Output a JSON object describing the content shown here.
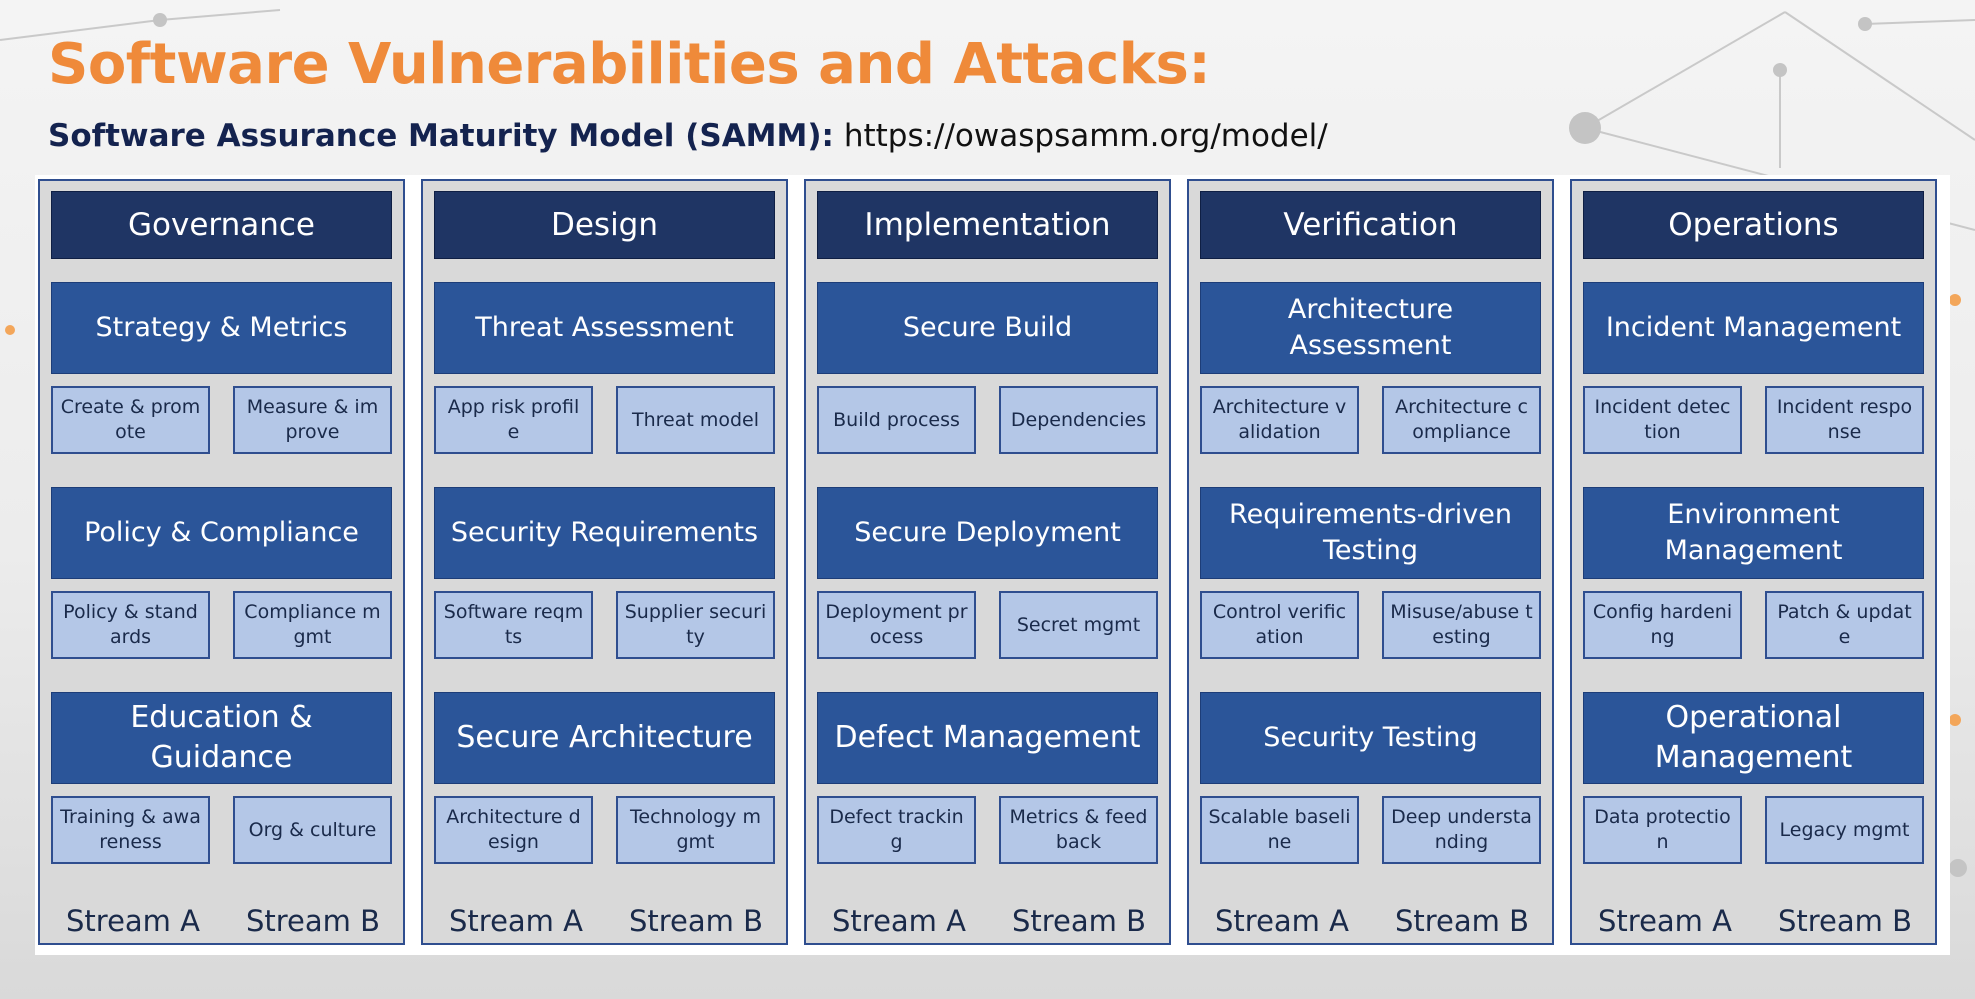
{
  "slide": {
    "title": "Software Vulnerabilities and Attacks:",
    "subtitle_bold": "Software Assurance Maturity Model (SAMM):",
    "subtitle_url": "https://owaspsamm.org/model/"
  },
  "colors": {
    "title": "#ef8a3a",
    "header": "#1f3564",
    "practice": "#2b5599",
    "activity": "#b4c7e7",
    "column": "#d9d9d9"
  },
  "columns": [
    {
      "header": "Governance",
      "practices": [
        {
          "label": "Strategy & Metrics",
          "activities": [
            "Create & promote",
            "Measure & improve"
          ]
        },
        {
          "label": "Policy & Compliance",
          "activities": [
            "Policy & standards",
            "Compliance mgmt"
          ]
        },
        {
          "label": "Education & Guidance",
          "activities": [
            "Training & awareness",
            "Org & culture"
          ]
        }
      ],
      "stream_a": "Stream A",
      "stream_b": "Stream B"
    },
    {
      "header": "Design",
      "practices": [
        {
          "label": "Threat Assessment",
          "activities": [
            "App risk profile",
            "Threat model"
          ]
        },
        {
          "label": "Security Requirements",
          "activities": [
            "Software reqmts",
            "Supplier security"
          ]
        },
        {
          "label": "Secure Architecture",
          "activities": [
            "Architecture design",
            "Technology mgmt"
          ]
        }
      ],
      "stream_a": "Stream A",
      "stream_b": "Stream B"
    },
    {
      "header": "Implementation",
      "practices": [
        {
          "label": "Secure Build",
          "activities": [
            "Build process",
            "Dependencies"
          ]
        },
        {
          "label": "Secure Deployment",
          "activities": [
            "Deployment process",
            "Secret mgmt"
          ]
        },
        {
          "label": "Defect Management",
          "activities": [
            "Defect tracking",
            "Metrics & feedback"
          ]
        }
      ],
      "stream_a": "Stream A",
      "stream_b": "Stream B"
    },
    {
      "header": "Verification",
      "practices": [
        {
          "label": "Architecture Assessment",
          "activities": [
            "Architecture validation",
            "Architecture compliance"
          ]
        },
        {
          "label": "Requirements-driven Testing",
          "activities": [
            "Control verification",
            "Misuse/abuse testing"
          ]
        },
        {
          "label": "Security Testing",
          "activities": [
            "Scalable baseline",
            "Deep understanding"
          ]
        }
      ],
      "stream_a": "Stream A",
      "stream_b": "Stream B"
    },
    {
      "header": "Operations",
      "practices": [
        {
          "label": "Incident Management",
          "activities": [
            "Incident detection",
            "Incident response"
          ]
        },
        {
          "label": "Environment Management",
          "activities": [
            "Config hardening",
            "Patch & update"
          ]
        },
        {
          "label": "Operational Management",
          "activities": [
            "Data protection",
            "Legacy mgmt"
          ]
        }
      ],
      "stream_a": "Stream A",
      "stream_b": "Stream B"
    }
  ]
}
